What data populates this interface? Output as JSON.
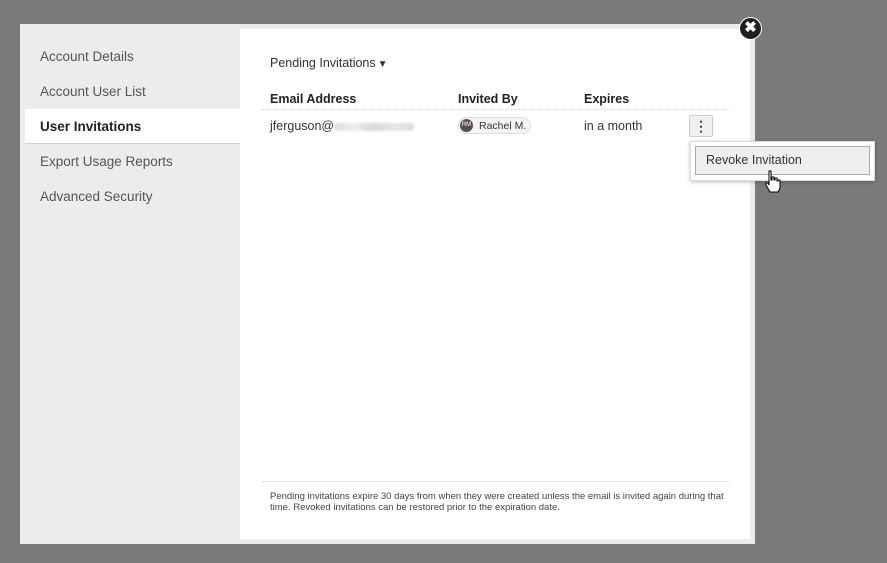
{
  "sidebar": {
    "items": [
      {
        "label": "Account Details",
        "active": false
      },
      {
        "label": "Account User List",
        "active": false
      },
      {
        "label": "User Invitations",
        "active": true
      },
      {
        "label": "Export Usage Reports",
        "active": false
      },
      {
        "label": "Advanced Security",
        "active": false
      }
    ]
  },
  "main": {
    "filter_label": "Pending Invitations",
    "filter_icon": "caret-down-icon",
    "table": {
      "columns": [
        "Email Address",
        "Invited By",
        "Expires"
      ],
      "rows": [
        {
          "email_visible": "jferguson@",
          "email_domain_redacted": true,
          "invited_by_initials": "RM",
          "invited_by_name": "Rachel M.",
          "expires": "in a month",
          "actions_icon": "kebab-menu-icon"
        }
      ]
    },
    "row_menu": {
      "items": [
        {
          "label": "Revoke Invitation"
        }
      ]
    },
    "footer_note": "Pending invitations expire 30 days from when they were created unless the email is invited again during that time. Revoked invitations can be restored prior to the expiration date."
  },
  "close_icon": "close-icon",
  "close_glyph": "✖",
  "kebab_glyph": "⋮",
  "caret_glyph": "▼"
}
